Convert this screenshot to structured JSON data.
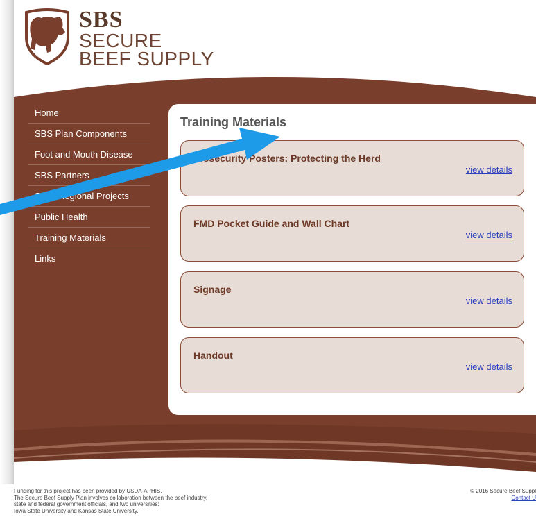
{
  "brand": {
    "logo_top": "SBS",
    "logo_line1": "SECURE",
    "logo_line2": "BEEF SUPPLY"
  },
  "sidebar": {
    "items": [
      {
        "label": "Home"
      },
      {
        "label": "SBS Plan Components"
      },
      {
        "label": "Foot and Mouth Disease"
      },
      {
        "label": "SBS Partners"
      },
      {
        "label": "State/Regional Projects"
      },
      {
        "label": "Public Health"
      },
      {
        "label": "Training Materials"
      },
      {
        "label": "Links"
      }
    ]
  },
  "main": {
    "title": "Training Materials",
    "cards": [
      {
        "title": "Biosecurity Posters: Protecting the Herd",
        "link": "view details"
      },
      {
        "title": "FMD Pocket Guide and Wall Chart",
        "link": "view details"
      },
      {
        "title": "Signage",
        "link": "view details"
      },
      {
        "title": "Handout",
        "link": "view details"
      }
    ]
  },
  "footer": {
    "left_lines": [
      "Funding for this project has been provided by USDA-APHIS.",
      "The Secure Beef Supply Plan involves collaboration between the beef industry,",
      "state and federal government officials, and two universities:",
      "Iowa State University and Kansas State University."
    ],
    "copyright": "© 2016 Secure Beef Suppl",
    "contact": "Contact U"
  },
  "colors": {
    "banner_brown": "#7a3f2c",
    "card_bg": "#e8dcd6",
    "card_title": "#6e3a28",
    "link": "#2a3fbf",
    "arrow": "#1e9be8"
  }
}
